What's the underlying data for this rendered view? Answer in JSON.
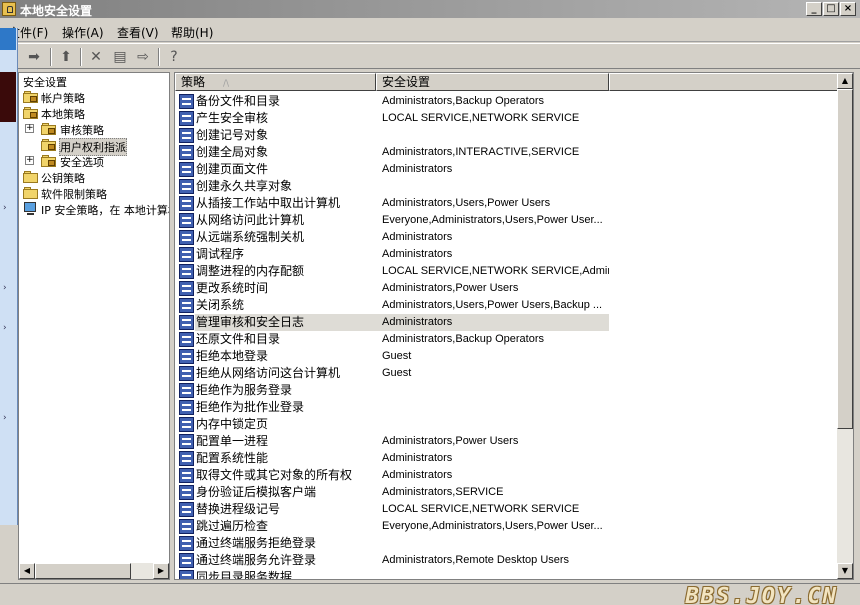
{
  "window": {
    "title": "本地安全设置",
    "buttons": [
      "_",
      "□",
      "×"
    ]
  },
  "menu": [
    "文件(F)",
    "操作(A)",
    "查看(V)",
    "帮助(H)"
  ],
  "toolbar": {
    "icons": [
      "back-icon",
      "forward-icon",
      "up-folder-icon",
      "delete-icon",
      "properties-icon",
      "export-list-icon",
      "help-icon"
    ]
  },
  "tree": {
    "items": [
      {
        "label": "安全设置",
        "level": 0,
        "icon": "none"
      },
      {
        "label": "帐户策略",
        "level": 0,
        "icon": "folder"
      },
      {
        "label": "本地策略",
        "level": 0,
        "icon": "folder"
      },
      {
        "label": "审核策略",
        "level": 1,
        "icon": "folder",
        "expander": "+"
      },
      {
        "label": "用户权利指派",
        "level": 1,
        "icon": "folder",
        "selected": true
      },
      {
        "label": "安全选项",
        "level": 1,
        "icon": "folder",
        "expander": "+"
      },
      {
        "label": "公钥策略",
        "level": 0,
        "icon": "folder"
      },
      {
        "label": "软件限制策略",
        "level": 0,
        "icon": "folder"
      },
      {
        "label": "IP 安全策略，在 本地计算机",
        "level": 0,
        "icon": "computer"
      }
    ]
  },
  "list": {
    "columns": [
      "策略",
      "安全设置"
    ],
    "sort_indicator": "/\\",
    "rows": [
      {
        "policy": "备份文件和目录",
        "setting": "Administrators,Backup Operators"
      },
      {
        "policy": "产生安全审核",
        "setting": "LOCAL SERVICE,NETWORK SERVICE"
      },
      {
        "policy": "创建记号对象",
        "setting": ""
      },
      {
        "policy": "创建全局对象",
        "setting": "Administrators,INTERACTIVE,SERVICE"
      },
      {
        "policy": "创建页面文件",
        "setting": "Administrators"
      },
      {
        "policy": "创建永久共享对象",
        "setting": ""
      },
      {
        "policy": "从插接工作站中取出计算机",
        "setting": "Administrators,Users,Power Users"
      },
      {
        "policy": "从网络访问此计算机",
        "setting": "Everyone,Administrators,Users,Power User..."
      },
      {
        "policy": "从远端系统强制关机",
        "setting": "Administrators"
      },
      {
        "policy": "调试程序",
        "setting": "Administrators"
      },
      {
        "policy": "调整进程的内存配额",
        "setting": "LOCAL SERVICE,NETWORK SERVICE,Admin..."
      },
      {
        "policy": "更改系统时间",
        "setting": "Administrators,Power Users"
      },
      {
        "policy": "关闭系统",
        "setting": "Administrators,Users,Power Users,Backup ..."
      },
      {
        "policy": "管理审核和安全日志",
        "setting": "Administrators",
        "selected": true
      },
      {
        "policy": "还原文件和目录",
        "setting": "Administrators,Backup Operators"
      },
      {
        "policy": "拒绝本地登录",
        "setting": "Guest"
      },
      {
        "policy": "拒绝从网络访问这台计算机",
        "setting": "Guest"
      },
      {
        "policy": "拒绝作为服务登录",
        "setting": ""
      },
      {
        "policy": "拒绝作为批作业登录",
        "setting": ""
      },
      {
        "policy": "内存中锁定页",
        "setting": ""
      },
      {
        "policy": "配置单一进程",
        "setting": "Administrators,Power Users"
      },
      {
        "policy": "配置系统性能",
        "setting": "Administrators"
      },
      {
        "policy": "取得文件或其它对象的所有权",
        "setting": "Administrators"
      },
      {
        "policy": "身份验证后模拟客户端",
        "setting": "Administrators,SERVICE"
      },
      {
        "policy": "替换进程级记号",
        "setting": "LOCAL SERVICE,NETWORK SERVICE"
      },
      {
        "policy": "跳过遍历检查",
        "setting": "Everyone,Administrators,Users,Power User..."
      },
      {
        "policy": "通过终端服务拒绝登录",
        "setting": ""
      },
      {
        "policy": "通过终端服务允许登录",
        "setting": "Administrators,Remote Desktop Users"
      },
      {
        "policy": "同步目录服务数据",
        "setting": ""
      }
    ]
  },
  "watermark": "BBS.JOY.CN"
}
